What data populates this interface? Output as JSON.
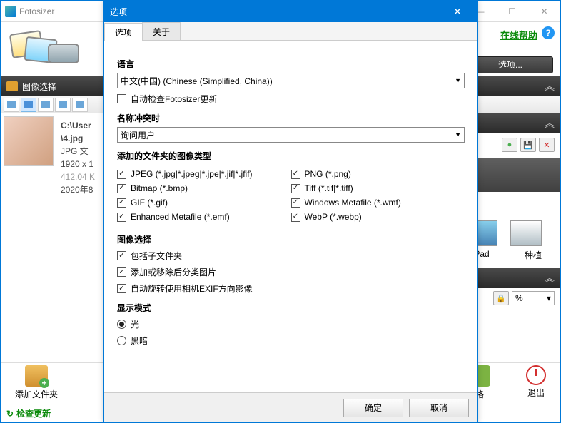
{
  "main_window": {
    "title": "Fotosizer",
    "help_link": "在线帮助",
    "options_button": "选项...",
    "image_select_header": "图像选择",
    "file": {
      "path": "C:\\User",
      "name": "\\4.jpg",
      "type": "JPG 文",
      "dimensions": "1920 x 1",
      "size": "412.04 K",
      "date": "2020年8"
    },
    "right_thumb_labels": {
      "pad": "Pad",
      "crop": "种植"
    },
    "percent_select": "%",
    "bottom": {
      "add_folder": "添加文件夹",
      "start_hint": "格",
      "exit": "退出"
    },
    "status": {
      "check_update": "检查更新"
    }
  },
  "dialog": {
    "title": "选项",
    "tabs": {
      "options": "选项",
      "about": "关于"
    },
    "sections": {
      "language": "语言",
      "language_value": "中文(中国) (Chinese (Simplified, China))",
      "auto_update": "自动检查Fotosizer更新",
      "name_conflict": "名称冲突时",
      "name_conflict_value": "询问用户",
      "added_types": "添加的文件夹的图像类型",
      "types": {
        "jpeg": "JPEG (*.jpg|*.jpeg|*.jpe|*.jif|*.jfif)",
        "png": "PNG (*.png)",
        "bmp": "Bitmap (*.bmp)",
        "tiff": "Tiff (*.tif|*.tiff)",
        "gif": "GIF (*.gif)",
        "wmf": "Windows Metafile (*.wmf)",
        "emf": "Enhanced Metafile (*.emf)",
        "webp": "WebP (*.webp)"
      },
      "image_select": "图像选择",
      "include_sub": "包括子文件夹",
      "sort_after": "添加或移除后分类图片",
      "auto_rotate": "自动旋转使用相机EXIF方向影像",
      "display_mode": "显示模式",
      "light": "光",
      "dark": "黑暗"
    },
    "buttons": {
      "ok": "确定",
      "cancel": "取消"
    }
  }
}
